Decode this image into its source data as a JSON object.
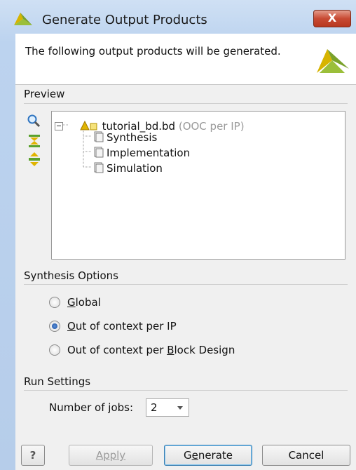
{
  "window": {
    "title": "Generate Output Products",
    "close_label": "X"
  },
  "banner": {
    "text": "The following output products will be generated."
  },
  "preview": {
    "label": "Preview",
    "side_icons": [
      "search-icon",
      "collapse-all-icon",
      "expand-all-icon"
    ],
    "tree": {
      "root_name": "tutorial_bd.bd",
      "root_note": "(OOC per IP)",
      "children": [
        "Synthesis",
        "Implementation",
        "Simulation"
      ]
    }
  },
  "synthesis_options": {
    "label": "Synthesis Options",
    "options": [
      {
        "pre": "",
        "key": "G",
        "post": "lobal",
        "checked": false
      },
      {
        "pre": "",
        "key": "O",
        "post": "ut of context per IP",
        "checked": true
      },
      {
        "pre": "Out of context per ",
        "key": "B",
        "post": "lock Design",
        "checked": false
      }
    ]
  },
  "run_settings": {
    "label": "Run Settings",
    "jobs_label_pre": "Number of ",
    "jobs_label_key": "j",
    "jobs_label_post": "obs:",
    "jobs_value": "2"
  },
  "buttons": {
    "help": "?",
    "apply": "Apply",
    "generate_pre": "G",
    "generate_key": "e",
    "generate_post": "nerate",
    "cancel": "Cancel"
  },
  "colors": {
    "accent_blue": "#3c7fb1",
    "close_red": "#c84a33",
    "logo_yellow": "#d7b400",
    "logo_green": "#7aa22b"
  }
}
